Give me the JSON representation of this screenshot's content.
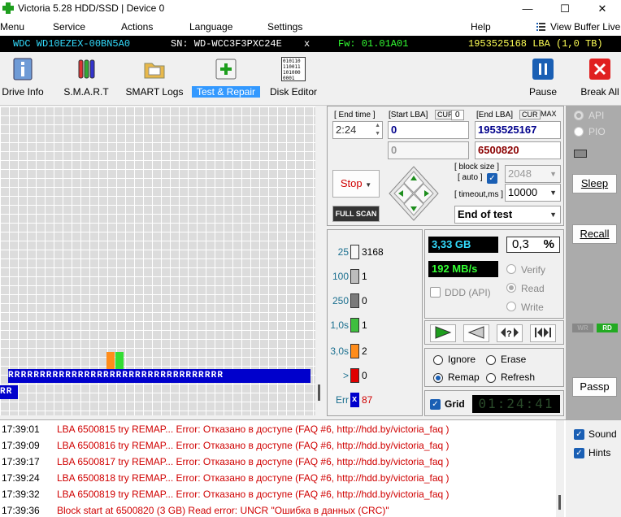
{
  "window": {
    "title": "Victoria 5.28 HDD/SSD | Device 0",
    "min": "—",
    "max": "☐",
    "close": "✕"
  },
  "menu": [
    "Menu",
    "Service",
    "Actions",
    "Language",
    "Settings",
    "Help"
  ],
  "view_buffer_live": "View Buffer Live",
  "device": {
    "model": "WDC WD10EZEX-00BN5A0",
    "serial": "SN: WD-WCC3F3PXC24E",
    "close": "x",
    "firmware": "Fw: 01.01A01",
    "lba": "1953525168 LBA (1,0 TB)"
  },
  "toolbar": {
    "drive_info": "Drive Info",
    "smart": "S.M.A.R.T",
    "smart_logs": "SMART Logs",
    "test_repair": "Test & Repair",
    "disk_editor": "Disk Editor",
    "disk_editor_glyph": [
      "010110",
      "110011",
      "101000",
      "0001"
    ],
    "pause": "Pause",
    "break_all": "Break All"
  },
  "test": {
    "end_time_label": "[ End time ]",
    "end_time": "2:24",
    "start_lba_label": "[Start LBA]",
    "cur_label": "CUR",
    "start_cur": "0",
    "end_lba_label": "[End LBA]",
    "max_label": "MAX",
    "start_lba": "0",
    "end_lba": "1953525167",
    "pos_start": "0",
    "pos_current": "6500820",
    "block_size_label": "[ block size ]",
    "auto_label": "[ auto ]",
    "block_size": "2048",
    "timeout_label": "[ timeout,ms ]",
    "timeout": "10000",
    "stop": "Stop",
    "full_scan": "FULL SCAN",
    "end_mode": "End of test"
  },
  "blocks": [
    {
      "label": "25",
      "count": "3168",
      "color": "#f8f8f8"
    },
    {
      "label": "100",
      "count": "1",
      "color": "#bdbdbd"
    },
    {
      "label": "250",
      "count": "0",
      "color": "#7a7a7a"
    },
    {
      "label": "1,0s",
      "count": "1",
      "color": "#3fbf3f"
    },
    {
      "label": "3,0s",
      "count": "2",
      "color": "#ff8c1a"
    },
    {
      "label": ">",
      "count": "0",
      "color": "#e00000"
    },
    {
      "label": "Err",
      "count": "87",
      "color": "#0000cc",
      "mark": "x"
    }
  ],
  "stats": {
    "size": "3,33 GB",
    "percent": "0,3",
    "percent_unit": "%",
    "speed": "192 MB/s",
    "ddd": "DDD (API)",
    "verify": "Verify",
    "read": "Read",
    "write": "Write"
  },
  "actions": {
    "ignore": "Ignore",
    "erase": "Erase",
    "remap": "Remap",
    "refresh": "Refresh",
    "grid": "Grid",
    "timer": "01:24:41"
  },
  "sidebar": {
    "api": "API",
    "pio": "PIO",
    "sleep": "Sleep",
    "recall": "Recall",
    "wr": "WR",
    "rd": "RD",
    "passp": "Passp",
    "sound": "Sound",
    "hints": "Hints"
  },
  "grid": {
    "row_letter": "R"
  },
  "log": [
    {
      "time": "17:39:01",
      "msg": "LBA 6500815 try REMAP... Error: Отказано в доступе (FAQ #6, http://hdd.by/victoria_faq )"
    },
    {
      "time": "17:39:09",
      "msg": "LBA 6500816 try REMAP... Error: Отказано в доступе (FAQ #6, http://hdd.by/victoria_faq )"
    },
    {
      "time": "17:39:17",
      "msg": "LBA 6500817 try REMAP... Error: Отказано в доступе (FAQ #6, http://hdd.by/victoria_faq )"
    },
    {
      "time": "17:39:24",
      "msg": "LBA 6500818 try REMAP... Error: Отказано в доступе (FAQ #6, http://hdd.by/victoria_faq )"
    },
    {
      "time": "17:39:32",
      "msg": "LBA 6500819 try REMAP... Error: Отказано в доступе (FAQ #6, http://hdd.by/victoria_faq )"
    },
    {
      "time": "17:39:36",
      "msg": "Block start at 6500820 (3 GB) Read error: UNCR \"Ошибка в данных (CRC)\""
    }
  ],
  "colors": {
    "accent": "#3399ff",
    "error_text": "#d00000",
    "lcd_green": "#33ff33",
    "lcd_cyan": "#33ddff",
    "remap_blue": "#0000cc"
  }
}
